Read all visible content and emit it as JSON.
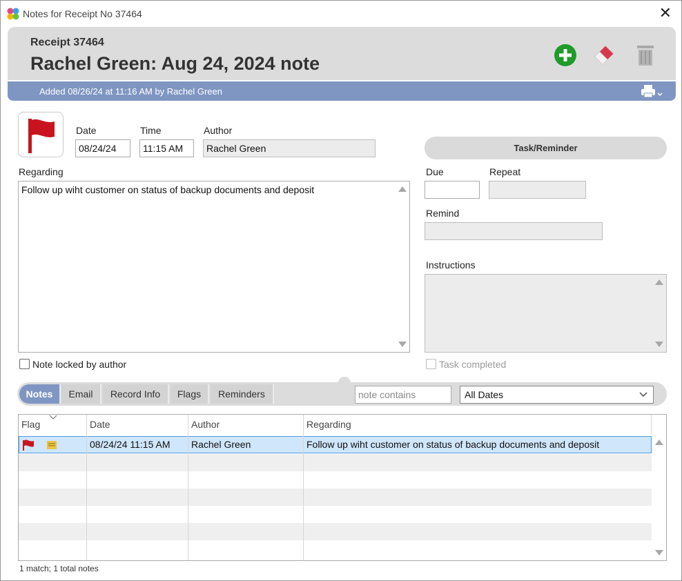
{
  "window": {
    "title": "Notes for Receipt No 37464",
    "close_glyph": "✕"
  },
  "header": {
    "receipt_label": "Receipt 37464",
    "note_title": "Rachel Green: Aug 24, 2024 note",
    "added_text": "Added 08/26/24 at 11:16 AM by Rachel Green",
    "buttons": [
      "add-icon",
      "eraser-icon",
      "trash-icon"
    ]
  },
  "form": {
    "date_label": "Date",
    "date_value": "08/24/24",
    "time_label": "Time",
    "time_value": "11:15 AM",
    "author_label": "Author",
    "author_value": "Rachel Green",
    "regarding_label": "Regarding",
    "regarding_value": "Follow up wiht customer on status of backup documents and deposit",
    "locked_label": "Note locked by author"
  },
  "task": {
    "button_label": "Task/Reminder",
    "due_label": "Due",
    "repeat_label": "Repeat",
    "remind_label": "Remind",
    "instructions_label": "Instructions",
    "completed_label": "Task completed"
  },
  "tabs": [
    "Notes",
    "Email",
    "Record Info",
    "Flags",
    "Reminders"
  ],
  "filter": {
    "search_placeholder": "note contains",
    "date_filter": "All Dates"
  },
  "table": {
    "columns": [
      "Flag",
      "Date",
      "Author",
      "Regarding"
    ],
    "rows": [
      {
        "flag": "red-flag",
        "date": "08/24/24 11:15 AM",
        "author": "Rachel Green",
        "regarding": "Follow up wiht customer on status of backup documents and deposit"
      }
    ]
  },
  "status": "1 match; 1 total notes",
  "colors": {
    "accent": "#7f96c2",
    "flag_red": "#c8141e",
    "add_green": "#1e9b2a"
  }
}
